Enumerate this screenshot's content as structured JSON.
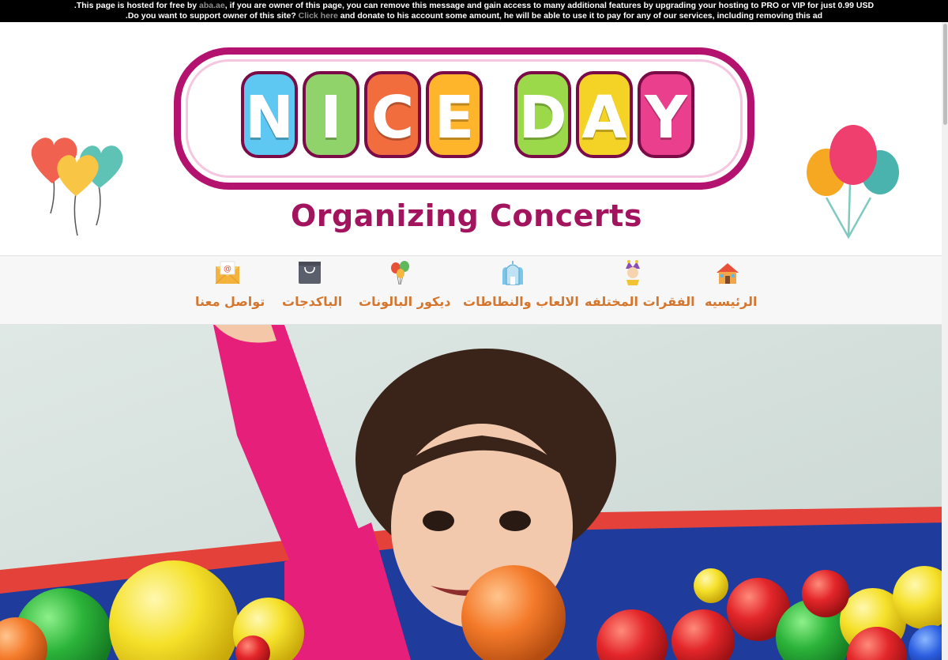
{
  "ad_banner": {
    "line1_pre": ".This page is hosted for free by ",
    "line1_link": "aba.ae",
    "line1_post": ", if you are owner of this page, you can remove this message and gain access to many additional features by upgrading your hosting to PRO or VIP for just 0.99 USD",
    "line2_pre": ".Do you want to support owner of this site? ",
    "line2_link": "Click here",
    "line2_post": " and donate to his account some amount, he will be able to use it to pay for any of our services, including removing this ad"
  },
  "logo": {
    "letters": [
      "N",
      "I",
      "C",
      "E",
      "D",
      "A",
      "Y"
    ],
    "letter_colors": [
      "#5ec8f2",
      "#8fd36a",
      "#f26d3d",
      "#ffb52b",
      "#9bd84a",
      "#f5d326",
      "#ea3f8c"
    ],
    "tagline": "Organizing Concerts"
  },
  "nav": {
    "items": [
      {
        "label": "الرئيسيه",
        "icon": "house-icon"
      },
      {
        "label": "الفقرات المختلفه",
        "icon": "jester-icon"
      },
      {
        "label": "الالعاب والنطاطات",
        "icon": "bouncy-castle-icon"
      },
      {
        "label": "ديكور البالونات",
        "icon": "balloons-icon"
      },
      {
        "label": "الباكدجات",
        "icon": "shopping-bag-icon"
      },
      {
        "label": "تواصل معنا",
        "icon": "envelope-icon"
      }
    ]
  },
  "colors": {
    "nav_text": "#d4762d",
    "logo_border": "#b3126e",
    "tagline": "#a3145e"
  }
}
